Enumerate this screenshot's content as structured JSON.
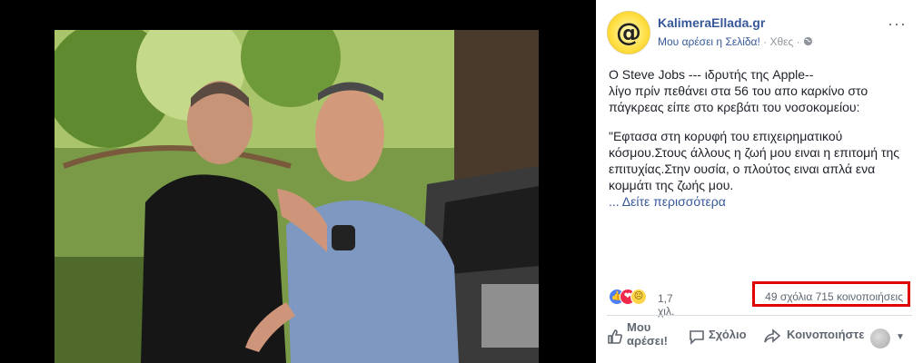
{
  "post": {
    "page_name": "KalimeraEllada.gr",
    "avatar_symbol": "@",
    "like_page_link": "Μου αρέσει η Σελίδα!",
    "separator": " · ",
    "time": "Χθες",
    "separator2": " · ",
    "more_menu": "···",
    "paragraph1": "O Steve Jobs --- ιδρυτής της Apple--\nλίγο πρίν πεθάνει στα 56 του απο καρκίνο στο πάγκρεας είπε στο κρεβάτι του νοσοκομείου:",
    "paragraph2": "\"Εφτασα στη κορυφή του επιχειρηματικού κόσμου.Στους άλλους η ζωή μου ειναι η επιτομή της επιτυχίας.Στην ουσία, ο πλούτος ειναι απλά ενα κομμάτι της ζωής μου.",
    "see_more": "... Δείτε περισσότερα"
  },
  "stats": {
    "reaction_count": "1,7 χιλ.",
    "comments_shares": "49 σχόλια  715 κοινοποιήσεις"
  },
  "actions": {
    "like": "Μου αρέσει!",
    "comment": "Σχόλιο",
    "share": "Κοινοποιήστε"
  },
  "colors": {
    "link": "#365899",
    "highlight_box": "#e00000",
    "text": "#1d2129",
    "meta": "#90949c"
  },
  "icons": [
    "globe-icon",
    "like-reaction-icon",
    "love-reaction-icon",
    "sad-reaction-icon",
    "thumbs-up-icon",
    "comment-icon",
    "share-icon",
    "caret-down-icon"
  ]
}
